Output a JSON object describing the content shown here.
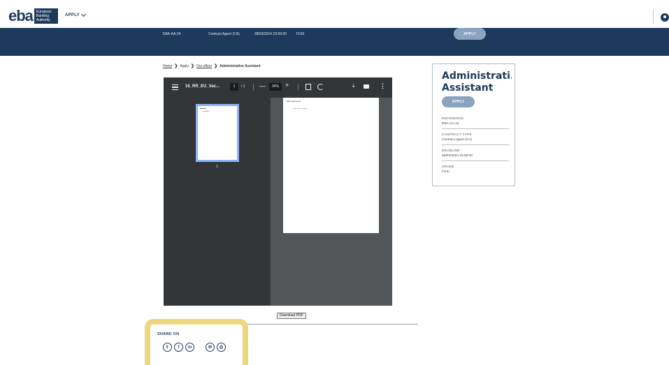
{
  "header": {
    "logo_text": "eba",
    "logo_sub": [
      "European",
      "Banking",
      "Authority"
    ],
    "nav_apply": "APPLY"
  },
  "band": {
    "reference": "EBA-AA-24",
    "contract": "Contract Agent (CA)",
    "deadline": "28/03/2024 23:59:00",
    "grade": "FGIII",
    "apply_label": "APPLY"
  },
  "breadcrumb": {
    "home": "Home",
    "apply": "Apply",
    "offers": "Our offers",
    "current": "Administrative Assistant",
    "separator": "❯"
  },
  "pdf": {
    "title": "16_RR_EU_Vac...",
    "page": "1",
    "of": "/ 1",
    "zoom": "34%",
    "minus": "—",
    "plus": "+",
    "download_glyph": "⤓",
    "more_glyph": "⋮",
    "thumb_num": "1",
    "sheet_line1": "EBA Negative test",
    "sheet_line2": "Title – Nazwa pozycji"
  },
  "download_pdf": "Download PDF",
  "share": {
    "label": "SHARE ON",
    "icons": [
      {
        "name": "twitter-icon",
        "glyph": "𝕥"
      },
      {
        "name": "facebook-icon",
        "glyph": "f"
      },
      {
        "name": "linkedin-icon",
        "glyph": "in"
      },
      {
        "name": "email-icon",
        "glyph": "✉"
      },
      {
        "name": "print-icon",
        "glyph": "⎙"
      }
    ]
  },
  "card": {
    "title_line1": "Administrati...",
    "title_line2": "Assistant",
    "apply_label": "APPLY",
    "fields": [
      {
        "label": "REFERENCE",
        "value": "EBA-AA-24"
      },
      {
        "label": "CONTRACT TYPE",
        "value": "Contract Agent (CA)"
      },
      {
        "label": "DEADLINE",
        "value": "28/03/2024 23:59:00"
      },
      {
        "label": "GRADE",
        "value": "FGIII"
      }
    ]
  },
  "colors": {
    "brand": "#1d3a5c",
    "apply_button": "#8aa4bf",
    "share_highlight": "#ecd77f",
    "pdf_toolbar": "#323639",
    "pdf_background": "#525659"
  }
}
